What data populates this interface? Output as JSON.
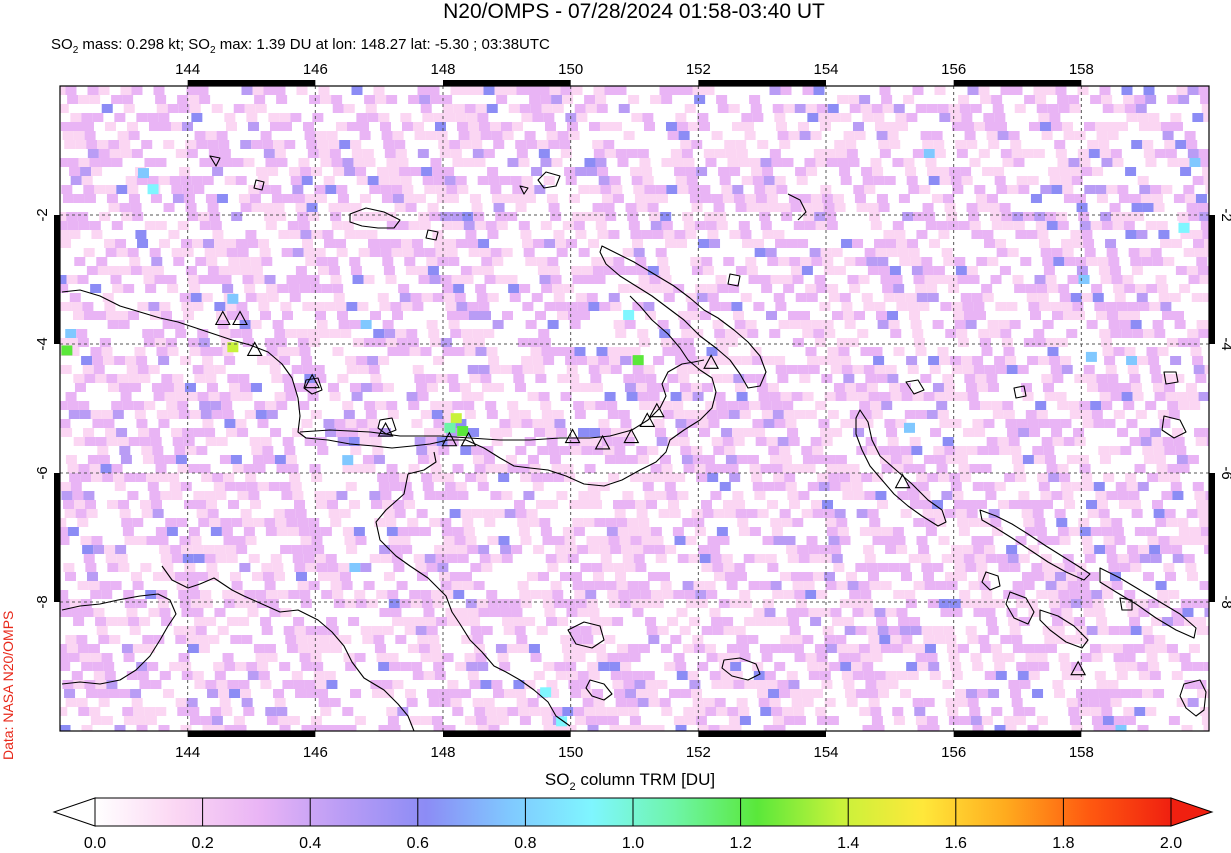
{
  "title": "N20/OMPS - 07/28/2024 01:58-03:40 UT",
  "subtitle": {
    "mass_prefix": "SO",
    "mass_sub": "2",
    "mass_text": " mass: 0.298 kt; SO",
    "max_sub": "2",
    "max_text": " max: 1.39 DU at lon: 148.27 lat: -5.30 ; 03:38UTC"
  },
  "credit": "Data: NASA N20/OMPS",
  "map": {
    "lon_ticks": [
      "144",
      "146",
      "148",
      "150",
      "152",
      "154",
      "156",
      "158"
    ],
    "lat_ticks": [
      "-2",
      "-4",
      "-6",
      "-8"
    ],
    "lon_range": [
      142,
      160
    ],
    "lat_range": [
      -10,
      0
    ],
    "gridlines": true
  },
  "colorbar": {
    "label_prefix": "SO",
    "label_sub": "2",
    "label_text": " column TRM [DU]",
    "ticks": [
      "0.0",
      "0.2",
      "0.4",
      "0.6",
      "0.8",
      "1.0",
      "1.2",
      "1.4",
      "1.6",
      "1.8",
      "2.0"
    ],
    "range": [
      0.0,
      2.0
    ],
    "colors": [
      "#ffffff",
      "#fbd6f3",
      "#e9b4f5",
      "#b99cf5",
      "#8c8cf5",
      "#80c8ff",
      "#7ff6ff",
      "#6ef5a8",
      "#5ae83a",
      "#c8f23a",
      "#ffe83a",
      "#ffab1e",
      "#ff5a10",
      "#f02010"
    ]
  },
  "volcanoes": [
    {
      "lon": 144.55,
      "lat": -3.62
    },
    {
      "lon": 144.82,
      "lat": -3.62
    },
    {
      "lon": 145.05,
      "lat": -4.1
    },
    {
      "lon": 145.95,
      "lat": -4.6
    },
    {
      "lon": 147.1,
      "lat": -5.35
    },
    {
      "lon": 148.1,
      "lat": -5.5
    },
    {
      "lon": 148.4,
      "lat": -5.5
    },
    {
      "lon": 150.03,
      "lat": -5.45
    },
    {
      "lon": 150.5,
      "lat": -5.55
    },
    {
      "lon": 150.95,
      "lat": -5.45
    },
    {
      "lon": 151.2,
      "lat": -5.2
    },
    {
      "lon": 151.35,
      "lat": -5.05
    },
    {
      "lon": 152.2,
      "lat": -4.3
    },
    {
      "lon": 155.2,
      "lat": -6.15
    },
    {
      "lon": 157.95,
      "lat": -9.05
    }
  ],
  "so2_highlights": [
    {
      "lon": 144.7,
      "lat": -4.05,
      "du": 1.35
    },
    {
      "lon": 148.2,
      "lat": -5.15,
      "du": 1.39
    },
    {
      "lon": 148.1,
      "lat": -5.3,
      "du": 1.1
    },
    {
      "lon": 148.3,
      "lat": -5.35,
      "du": 1.3
    },
    {
      "lon": 151.05,
      "lat": -4.25,
      "du": 1.25
    },
    {
      "lon": 142.1,
      "lat": -4.1,
      "du": 1.3
    },
    {
      "lon": 143.45,
      "lat": -1.6,
      "du": 0.9
    },
    {
      "lon": 143.3,
      "lat": -1.35,
      "du": 0.75
    },
    {
      "lon": 144.7,
      "lat": -3.3,
      "du": 0.8
    },
    {
      "lon": 150.9,
      "lat": -3.55,
      "du": 0.85
    },
    {
      "lon": 149.6,
      "lat": -9.4,
      "du": 0.85
    },
    {
      "lon": 149.85,
      "lat": -9.85,
      "du": 0.95
    },
    {
      "lon": 159.6,
      "lat": -2.2,
      "du": 0.85
    },
    {
      "lon": 158.15,
      "lat": -4.2,
      "du": 0.8
    },
    {
      "lon": 155.3,
      "lat": -5.3,
      "du": 0.7
    },
    {
      "lon": 146.5,
      "lat": -5.8,
      "du": 0.7
    }
  ]
}
